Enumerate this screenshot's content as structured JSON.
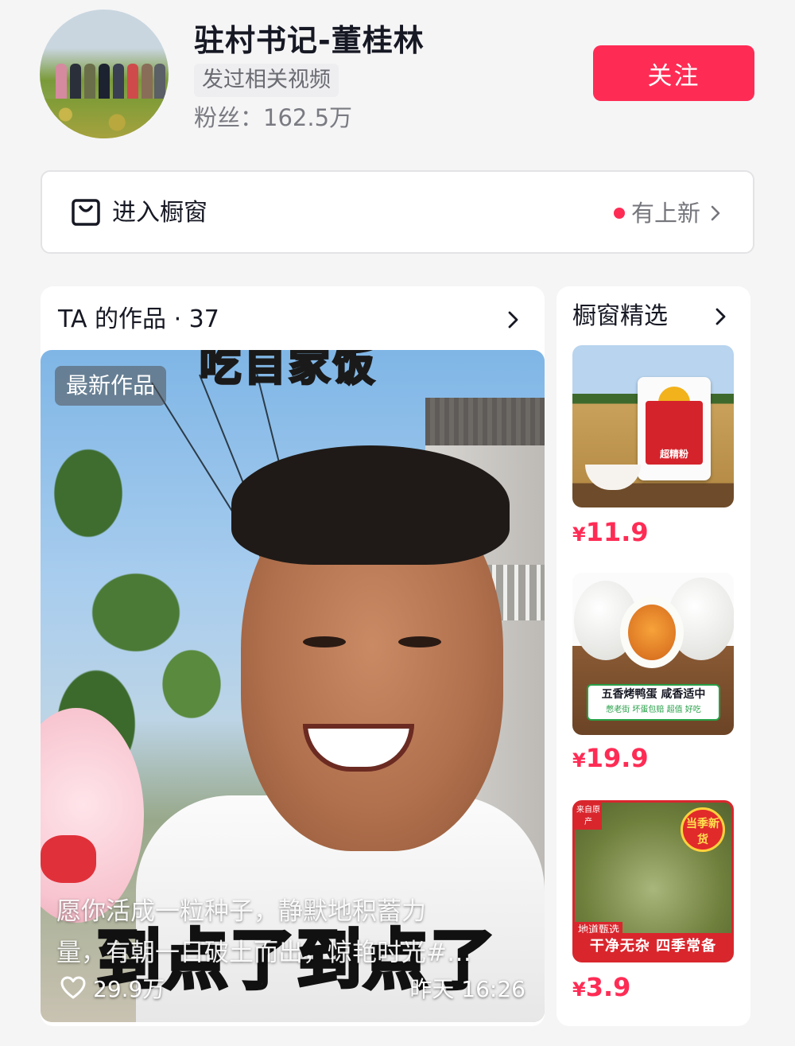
{
  "profile": {
    "name": "驻村书记-董桂林",
    "tag": "发过相关视频",
    "fans": "粉丝：162.5万",
    "follow_label": "关注"
  },
  "shop": {
    "label": "进入橱窗",
    "status": "有上新",
    "accent": "#fe2c55"
  },
  "works": {
    "title": "TA 的作品 · 37",
    "video": {
      "badge": "最新作品",
      "top_caption": "吃自家饭",
      "subtitle_a": "到点了",
      "subtitle_b": "到点了",
      "desc_line1": "愿你活成一粒种子，静默地积蓄力",
      "desc_line2": "量，有朝一日破土而出，惊艳时光#…",
      "likes": "29.9万",
      "time": "昨天 16:26"
    }
  },
  "picks": {
    "title": "橱窗精选",
    "items": [
      {
        "price_symbol": "¥",
        "price": "11.9",
        "image_text": "超精粉"
      },
      {
        "price_symbol": "¥",
        "price": "19.9",
        "image_text": "五香烤鸭蛋 咸香适中",
        "image_subtext": "憋老街 坏蛋包赔 超值 好吃"
      },
      {
        "price_symbol": "¥",
        "price": "3.9",
        "image_text": "干净无杂 四季常备",
        "badge": "当季新货",
        "corner": "来自原产",
        "tag": "地道甄选"
      }
    ]
  }
}
